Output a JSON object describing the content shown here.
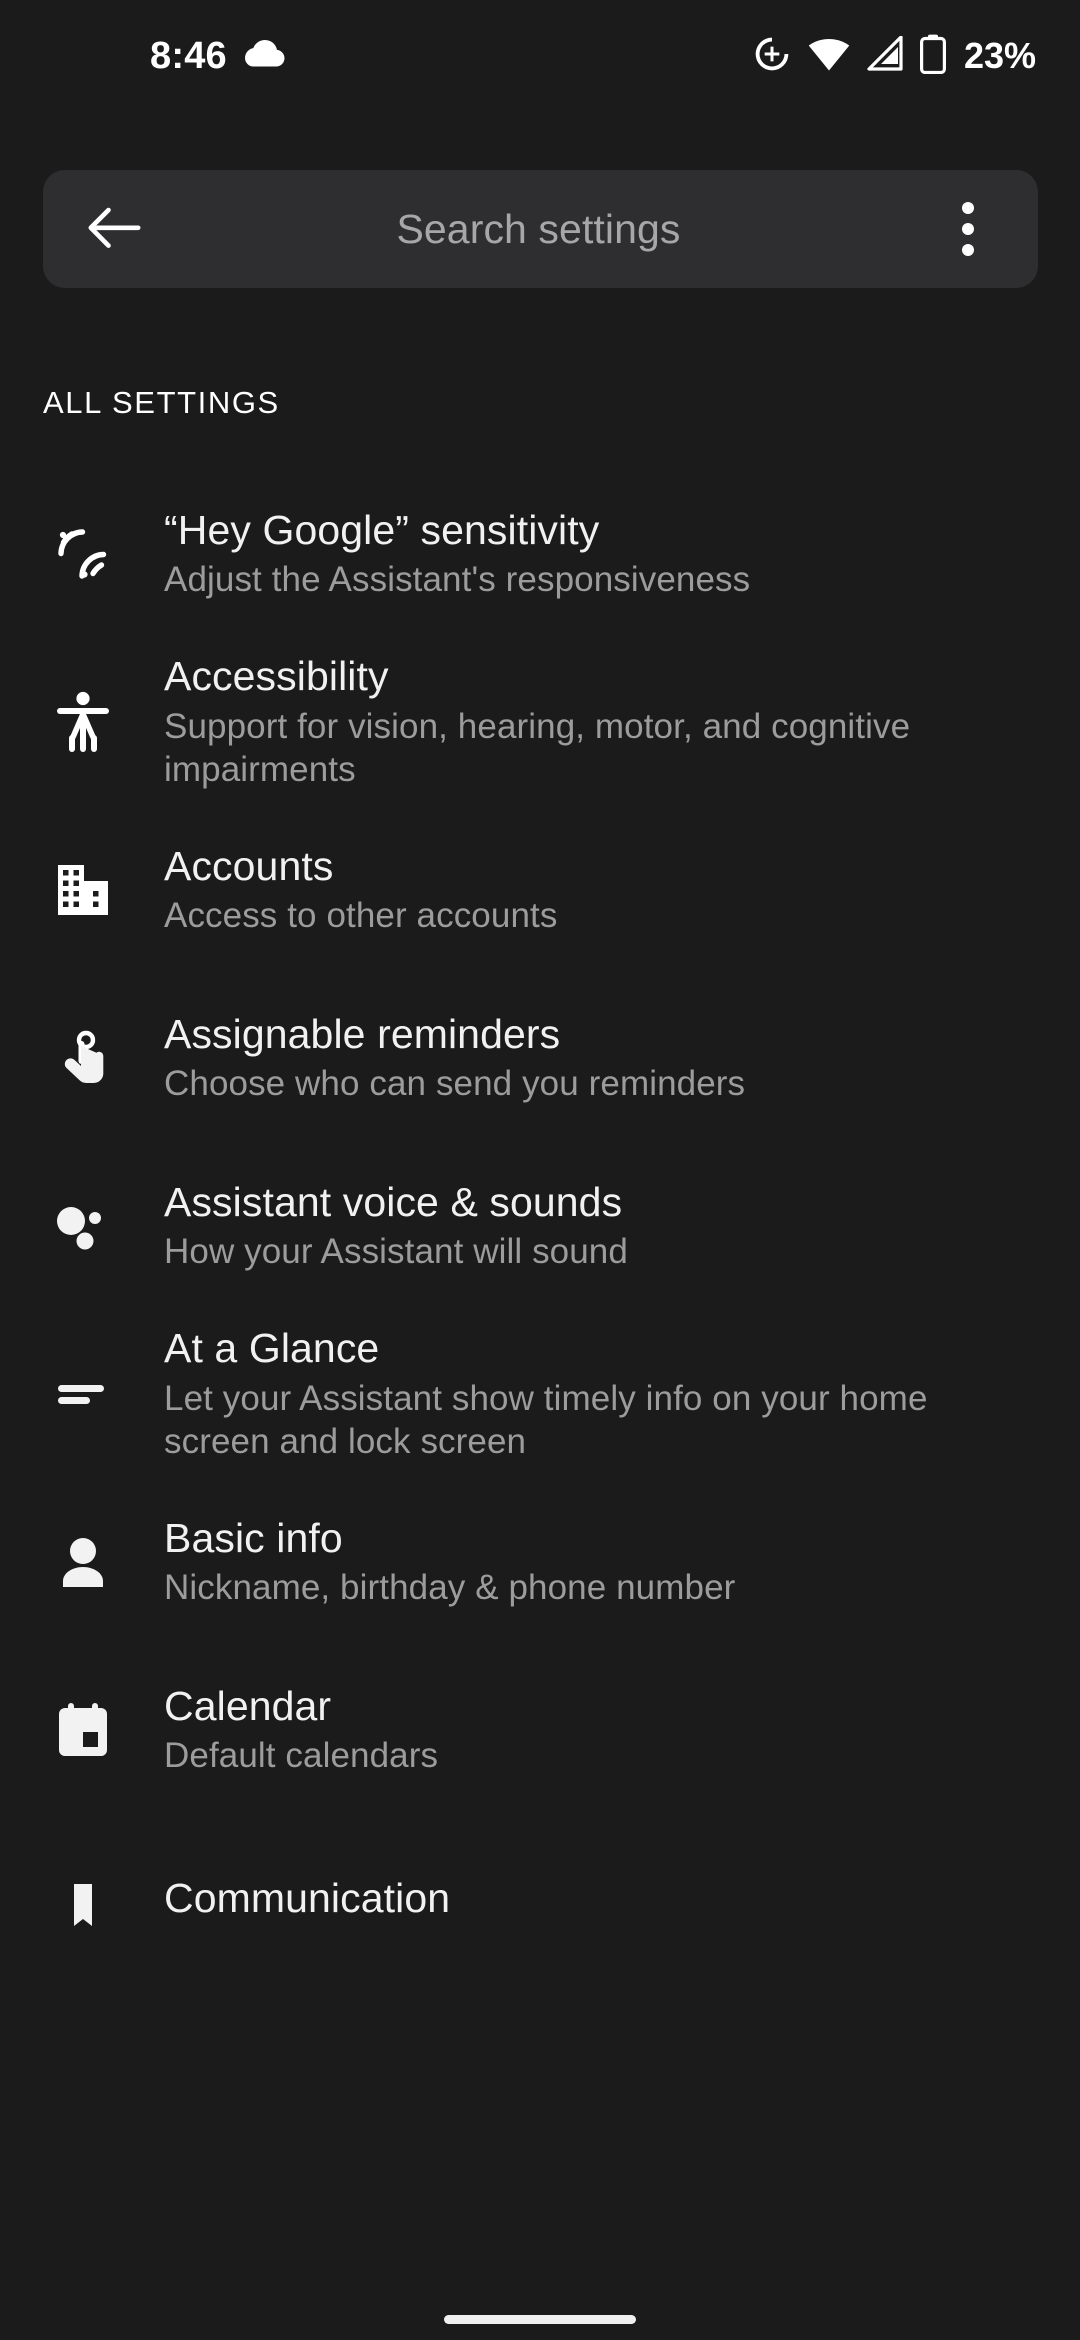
{
  "status_bar": {
    "time": "8:46",
    "weather_icon": "cloud-icon",
    "icons": [
      "location-crosshair-icon",
      "wifi-icon",
      "cellular-signal-icon",
      "battery-icon"
    ],
    "battery_percent": "23%"
  },
  "search": {
    "back_icon": "back-arrow-icon",
    "placeholder": "Search settings",
    "overflow_icon": "more-vertical-icon"
  },
  "section": {
    "header": "ALL SETTINGS"
  },
  "items": [
    {
      "icon": "sensitivity-waves-icon",
      "title": "“Hey Google” sensitivity",
      "subtitle": "Adjust the Assistant's responsiveness"
    },
    {
      "icon": "accessibility-person-icon",
      "title": "Accessibility",
      "subtitle": "Support for vision, hearing, motor, and cognitive impairments"
    },
    {
      "icon": "building-domain-icon",
      "title": "Accounts",
      "subtitle": "Access to other accounts"
    },
    {
      "icon": "finger-string-reminder-icon",
      "title": "Assignable reminders",
      "subtitle": "Choose who can send you reminders"
    },
    {
      "icon": "assistant-dots-icon",
      "title": "Assistant voice & sounds",
      "subtitle": "How your Assistant will sound"
    },
    {
      "icon": "short-text-lines-icon",
      "title": "At a Glance",
      "subtitle": "Let your Assistant show timely info on your home screen and lock screen"
    },
    {
      "icon": "person-icon",
      "title": "Basic info",
      "subtitle": "Nickname, birthday & phone number"
    },
    {
      "icon": "calendar-icon",
      "title": "Calendar",
      "subtitle": "Default calendars"
    },
    {
      "icon": "bookmark-partial-icon",
      "title": "Communication",
      "subtitle": ""
    }
  ],
  "colors": {
    "background": "#1b1b1b",
    "search_bar": "#2e2e30",
    "title_text": "#f1f1f1",
    "subtitle_text": "#9c9c9c",
    "accent_white": "#ffffff"
  },
  "nav": {
    "gesture_pill": "home-gesture-pill"
  }
}
